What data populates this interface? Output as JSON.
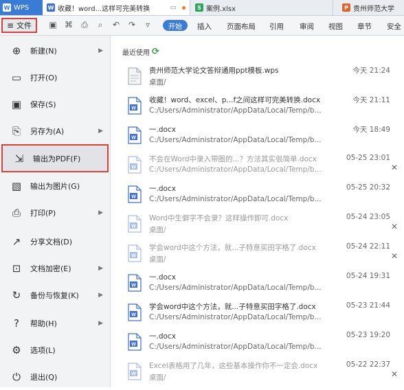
{
  "tabs": {
    "wps": "WPS",
    "doc": "收藏！word...这样可完美转换",
    "xls": "案例.xlsx",
    "ppt": "贵州师范大学"
  },
  "ribbon": {
    "file_label": "文件",
    "start": "开始",
    "items": [
      "插入",
      "页面布局",
      "引用",
      "审阅",
      "视图",
      "章节",
      "安全"
    ]
  },
  "menu": {
    "items": [
      {
        "label": "新建(N)",
        "icon": "new-file-icon",
        "arrow": true
      },
      {
        "label": "打开(O)",
        "icon": "folder-open-icon",
        "arrow": false
      },
      {
        "label": "保存(S)",
        "icon": "save-icon",
        "arrow": false
      },
      {
        "label": "另存为(A)",
        "icon": "save-as-icon",
        "arrow": true
      },
      {
        "label": "输出为PDF(F)",
        "icon": "export-pdf-icon",
        "arrow": false,
        "highlighted": true
      },
      {
        "label": "输出为图片(G)",
        "icon": "export-image-icon",
        "arrow": false
      },
      {
        "label": "打印(P)",
        "icon": "print-icon",
        "arrow": true
      },
      {
        "label": "分享文档(D)",
        "icon": "share-icon",
        "arrow": false
      },
      {
        "label": "文档加密(E)",
        "icon": "encrypt-icon",
        "arrow": true
      },
      {
        "label": "备份与恢复(K)",
        "icon": "backup-icon",
        "arrow": true
      },
      {
        "label": "帮助(H)",
        "icon": "help-icon",
        "arrow": true
      },
      {
        "label": "选项(L)",
        "icon": "options-icon",
        "arrow": false
      },
      {
        "label": "退出(Q)",
        "icon": "exit-icon",
        "arrow": false
      }
    ]
  },
  "recent": {
    "title": "最近使用",
    "files": [
      {
        "name": "贵州师范大学论文答辩通用ppt模板.wps",
        "path": "桌面/",
        "time": "今天 21:24",
        "type": "wps",
        "dim": false,
        "close": false
      },
      {
        "name": "收藏！word、excel、p...f之间这样可完美转换.docx",
        "path": "C:/Users/Administrator/AppData/Local/Temp/b...",
        "time": "今天 21:11",
        "type": "word",
        "dim": false,
        "close": false
      },
      {
        "name": "一.docx",
        "path": "C:/Users/Administrator/AppData/Local/Temp/b...",
        "time": "今天 18:49",
        "type": "word",
        "dim": false,
        "close": false
      },
      {
        "name": "不会在Word中录入带圈的...？方法其实很简单.docx",
        "path": "C:/Users/Administrator/AppData/Local/Temp/b...",
        "time": "05-25 23:01",
        "type": "word",
        "dim": true,
        "close": true
      },
      {
        "name": "一.docx",
        "path": "C:/Users/Administrator/AppData/Local/Temp/b...",
        "time": "05-25 20:32",
        "type": "word",
        "dim": false,
        "close": false
      },
      {
        "name": "Word中生僻字不会录？这样操作即可.docx",
        "path": "桌面/",
        "time": "05-24 23:05",
        "type": "word",
        "dim": true,
        "close": true
      },
      {
        "name": "学会word中这个方法，就...子特意买田字格了.docx",
        "path": "桌面/",
        "time": "05-24 22:11",
        "type": "word",
        "dim": true,
        "close": true
      },
      {
        "name": "一.docx",
        "path": "C:/Users/Administrator/AppData/Local/Temp/b...",
        "time": "05-24 19:31",
        "type": "word",
        "dim": false,
        "close": false
      },
      {
        "name": "学会word中这个方法，就...子特意买田字格了.docx",
        "path": "C:/Users/Administrator/AppData/Local/Temp/b...",
        "time": "05-23 21:44",
        "type": "word",
        "dim": false,
        "close": false
      },
      {
        "name": "一.docx",
        "path": "C:/Users/Administrator/AppData/Local/Temp/b...",
        "time": "05-23 19:20",
        "type": "word",
        "dim": false,
        "close": false
      },
      {
        "name": "Excel表格用了几年，这些基本操作你不一定会.docx",
        "path": "桌面/",
        "time": "05-22 22:37",
        "type": "word",
        "dim": true,
        "close": true
      }
    ]
  }
}
